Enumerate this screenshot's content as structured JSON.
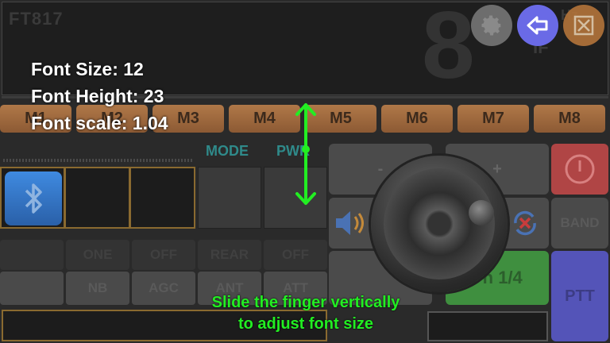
{
  "display": {
    "radio_model": "FT817",
    "frequency_digit": "8",
    "if_label": "IF",
    "hz_label": "Hz"
  },
  "top_buttons": [
    {
      "name": "settings",
      "icon": "gear-icon"
    },
    {
      "name": "back",
      "icon": "back-arrow-icon"
    },
    {
      "name": "close",
      "icon": "close-icon"
    }
  ],
  "memories": [
    "M1",
    "M2",
    "M3",
    "M4",
    "M5",
    "M6",
    "M7",
    "M8"
  ],
  "labels": {
    "mode": "MODE",
    "pwr": "PWR"
  },
  "row1": [
    "",
    "ONE",
    "OFF",
    "REAR",
    "OFF"
  ],
  "row2": [
    "",
    "NB",
    "AGC",
    "ANT",
    "ATT"
  ],
  "right": {
    "minus": "-",
    "plus": "+",
    "band": "BAND",
    "fn": "Fn 1/4",
    "ptt": "PTT"
  },
  "overlay": {
    "font_size": "Font Size: 12",
    "font_height": "Font Height: 23",
    "font_scale": "Font scale: 1.04",
    "hint_line1": "Slide the finger vertically",
    "hint_line2": "to adjust font size"
  },
  "colors": {
    "accent_back": "#6a6ae6",
    "hint_green": "#22ee22",
    "memory_button": "#a06a40",
    "power_red": "#b04545",
    "ptt_blue": "#5454b8",
    "fn_green": "#3f8f3f"
  }
}
